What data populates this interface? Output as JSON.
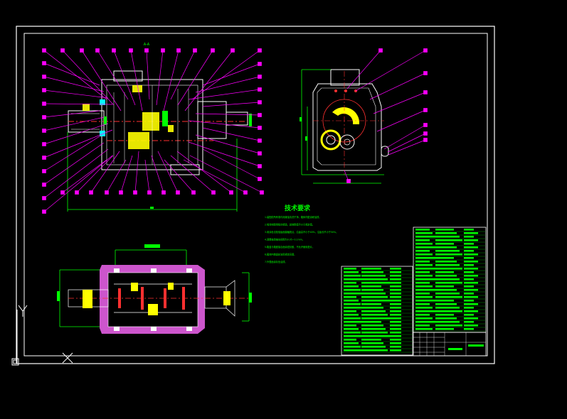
{
  "drawing": {
    "section_label": "A-A",
    "tech_requirements": {
      "title": "技术要求",
      "items": [
        "1.装配前所有零件用煤油清洗干净，箱体内壁涂耐油漆。",
        "2.啮合侧隙用铅丝检验，其侧隙值不小于规定值。",
        "3.用涂色法检验齿面接触斑点，沿齿高不小于40%，沿齿长不小于50%。",
        "4.调整轴承轴向间隙为0.05~0.1mm。",
        "5.箱盖与箱座接合面涂密封胶，不允许使用垫片。",
        "6.箱体内装齿轮油至规定高度。",
        "7.外表面涂灰色油漆。"
      ]
    },
    "colors": {
      "background": "#000000",
      "frame": "#ffffff",
      "callout": "#ff00ff",
      "dimension": "#00ff00",
      "section": "#ff66ff",
      "gear": "#ffff00",
      "part": "#ffffff",
      "accent_red": "#ff3030",
      "accent_cyan": "#00ffff"
    },
    "ucs": {
      "x_label": "X",
      "y_label": "Y"
    }
  }
}
